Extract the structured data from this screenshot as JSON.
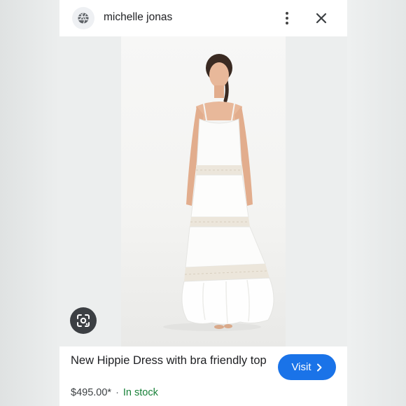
{
  "header": {
    "site_name": "michelle jonas",
    "site_icon": "globe-icon",
    "menu_icon": "more-vert-icon",
    "close_icon": "close-icon"
  },
  "image": {
    "lens_icon": "google-lens-icon"
  },
  "product": {
    "title": "New Hippie Dress with bra friendly top",
    "price": "$495.00*",
    "separator": "·",
    "availability": "In stock",
    "visit_label": "Visit",
    "visit_icon": "chevron-right-icon"
  },
  "colors": {
    "accent": "#1a73e8",
    "in_stock": "#188038",
    "text": "#202124"
  }
}
